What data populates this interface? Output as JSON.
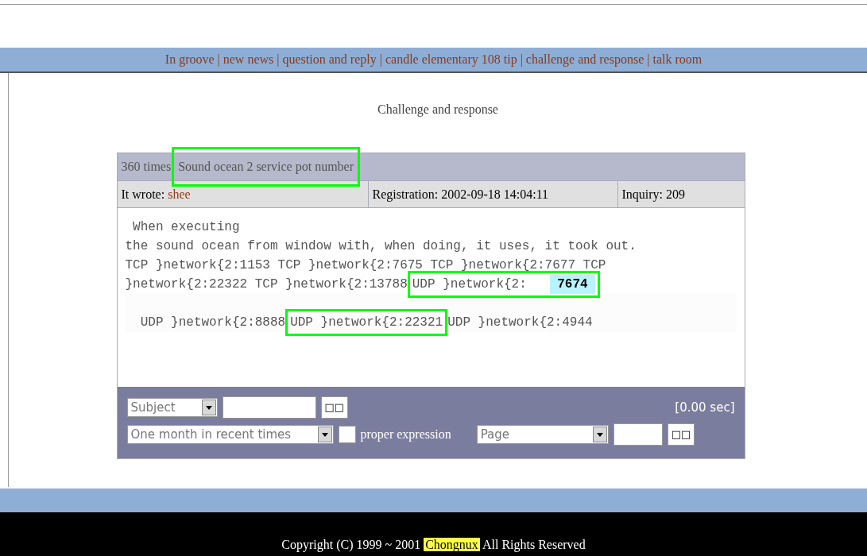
{
  "nav_separator": "|",
  "nav": [
    "In groove",
    "new news",
    "question and reply",
    "candle elementary 108 tip",
    "challenge and response",
    "talk room"
  ],
  "page_title": "Challenge and response",
  "post": {
    "count": "360 times",
    "title": "Sound ocean 2 service pot number",
    "title_boxed": true,
    "author_label": "It wrote:",
    "author": "shee",
    "registration": "Registration: 2002-09-18 14:04:11",
    "inquiry": "Inquiry: 209",
    "lines": [
      {
        "blank_before": false,
        "segments": [
          {
            "boxed": false,
            "parts": [
              {
                "text": " When executing",
                "emphasis": false
              }
            ]
          }
        ]
      },
      {
        "blank_before": false,
        "segments": [
          {
            "boxed": false,
            "parts": [
              {
                "text": "the sound ocean from window with, when doing, it uses, it took out.",
                "emphasis": false
              }
            ]
          }
        ]
      },
      {
        "blank_before": false,
        "segments": [
          {
            "boxed": false,
            "parts": [
              {
                "text": "TCP }network{2:1153 TCP }network{2:7675 TCP }network{2:7677 TCP",
                "emphasis": false
              }
            ]
          }
        ]
      },
      {
        "blank_before": false,
        "segments": [
          {
            "boxed": false,
            "parts": [
              {
                "text": "}network{2:22322 TCP }network{2:13788",
                "emphasis": false
              }
            ]
          },
          {
            "boxed": true,
            "parts": [
              {
                "text": "UDP }network{2:   ",
                "emphasis": false
              },
              {
                "text": " 7674 ",
                "emphasis": true
              }
            ]
          }
        ]
      },
      {
        "blank_before": true,
        "segments": [
          {
            "boxed": false,
            "parts": [
              {
                "text": "  UDP }network{2:8888",
                "emphasis": false
              }
            ]
          },
          {
            "boxed": true,
            "parts": [
              {
                "text": "UDP }network{2:22321",
                "emphasis": false
              }
            ]
          },
          {
            "boxed": false,
            "parts": [
              {
                "text": "UDP }network{2:4944",
                "emphasis": false
              }
            ]
          }
        ]
      }
    ]
  },
  "search": {
    "field_select": "Subject",
    "go": "□□",
    "time": "[0.00 sec]",
    "period_select": "One month in recent times",
    "regex_checked": false,
    "regex_label": "proper expression",
    "page_select": "Page",
    "page_go": "□□"
  },
  "footer": {
    "before": "Copyright (C) 1999 ~ 2001",
    "brand": "Chongnux",
    "after": "All Rights Reserved"
  }
}
